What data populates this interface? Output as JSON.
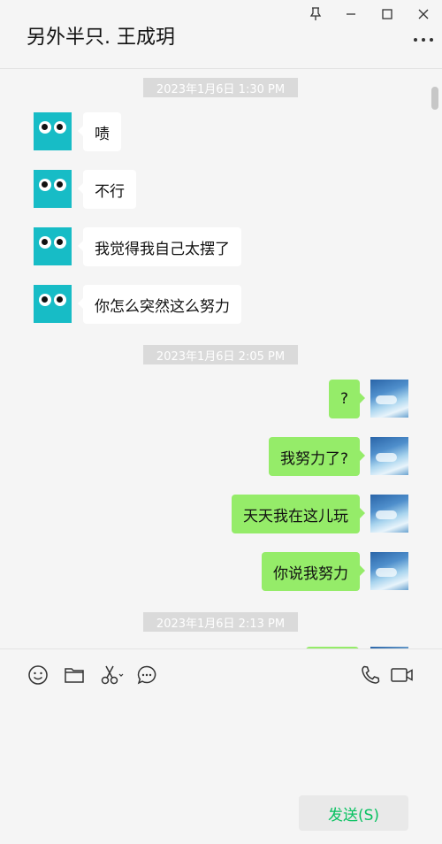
{
  "window": {
    "title": "另外半只. 王成玥",
    "controls": [
      "pin-icon",
      "minimize-icon",
      "maximize-icon",
      "close-icon"
    ],
    "more_icon": "more-dots-icon"
  },
  "chat": {
    "timestamps": [
      "2023年1月6日 1:30 PM",
      "2023年1月6日 2:05 PM",
      "2023年1月6日 2:13 PM"
    ],
    "incoming": [
      {
        "text": "啧"
      },
      {
        "text": "不行"
      },
      {
        "text": "我觉得我自己太摆了"
      },
      {
        "text": "你怎么突然这么努力"
      }
    ],
    "outgoing": [
      {
        "text": "?"
      },
      {
        "text": "我努力了?"
      },
      {
        "text": "天天我在这儿玩"
      },
      {
        "text": "你说我努力"
      }
    ]
  },
  "toolbar": {
    "icons": [
      "emoji-icon",
      "folder-icon",
      "scissors-icon",
      "chat-history-icon",
      "phone-icon",
      "video-icon"
    ],
    "send_label": "发送(S)"
  },
  "colors": {
    "background": "#f5f5f5",
    "outgoing_bubble": "#95ec69",
    "incoming_bubble": "#ffffff",
    "send_text": "#07c160",
    "owl_avatar": "#17bcc6"
  }
}
